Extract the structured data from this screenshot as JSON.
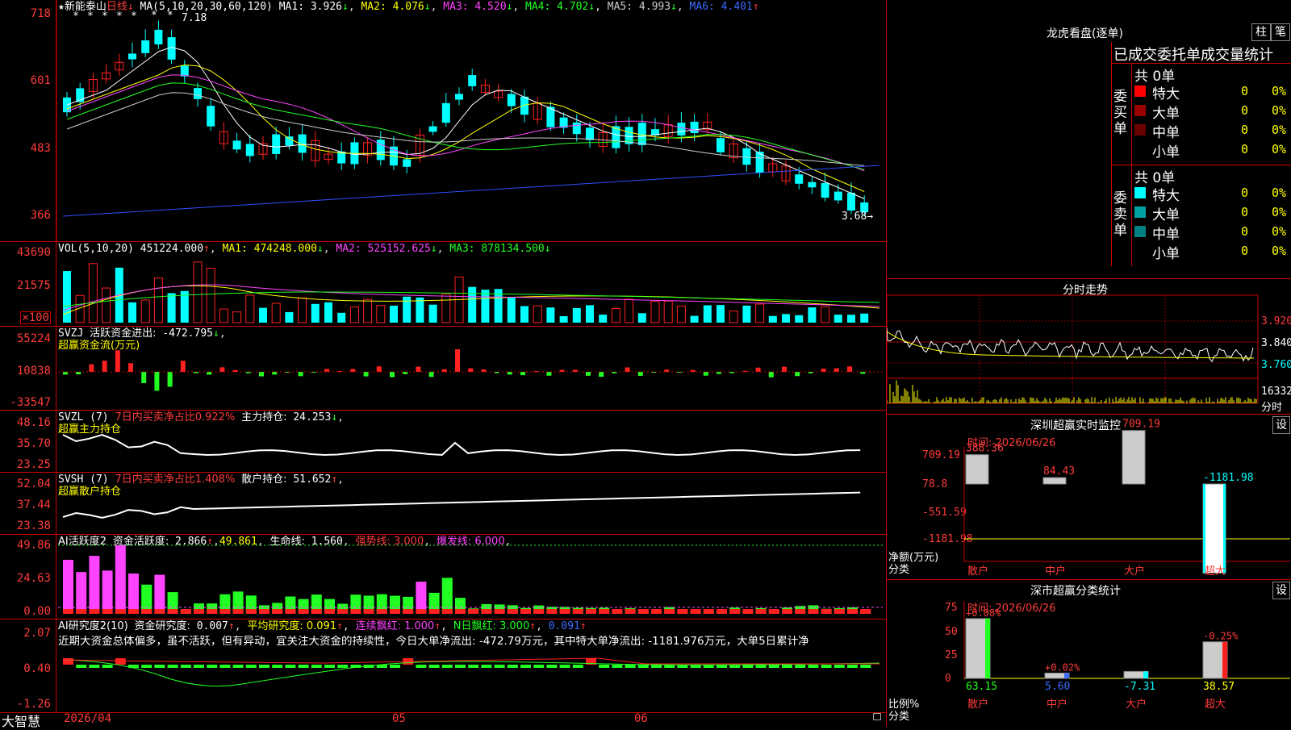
{
  "kline": {
    "name": "新能泰山",
    "period": "日线",
    "ma_label": "MA(5,10,20,30,60,120)",
    "ma": [
      {
        "label": "MA1:",
        "value": "3.926",
        "dir": "↓",
        "color": "#ffffff"
      },
      {
        "label": "MA2:",
        "value": "4.076",
        "dir": "↓",
        "color": "#ffff00"
      },
      {
        "label": "MA3:",
        "value": "4.520",
        "dir": "↓",
        "color": "#ff44ff"
      },
      {
        "label": "MA4:",
        "value": "4.702",
        "dir": "↓",
        "color": "#22ff22"
      },
      {
        "label": "MA5:",
        "value": "4.993",
        "dir": "↓",
        "color": "#cccccc"
      },
      {
        "label": "MA6:",
        "value": "4.401",
        "dir": "↑",
        "color": "#3b6bff"
      }
    ],
    "y_ticks": [
      "718",
      "601",
      "483",
      "366"
    ],
    "high_label": "7.18",
    "last_label": "3.68"
  },
  "vol": {
    "label": "VOL(5,10,20)",
    "value": "451224.000",
    "dir": "↑",
    "ma": [
      {
        "label": "MA1:",
        "value": "474248.000",
        "dir": "↓",
        "color": "#ffff00"
      },
      {
        "label": "MA2:",
        "value": "525152.625",
        "dir": "↓",
        "color": "#ff44ff"
      },
      {
        "label": "MA3:",
        "value": "878134.500",
        "dir": "↓",
        "color": "#22ff22"
      }
    ],
    "y_ticks": [
      "43690",
      "21575"
    ],
    "unit": "×100"
  },
  "svzj": {
    "label": "SVZJ",
    "item": "活跃资金进出:",
    "value": "-472.795",
    "dir": "↓",
    "sub": "超赢资金流(万元)",
    "y_ticks": [
      "55224",
      "10838",
      "-33547"
    ]
  },
  "svzl": {
    "label": "SVZL (7)",
    "item": "7日内买卖净占比0.922%",
    "item2": "主力持仓:",
    "value": "24.253",
    "dir": "↓",
    "sub": "超赢主力持仓",
    "y_ticks": [
      "48.16",
      "35.70",
      "23.25"
    ]
  },
  "svsh": {
    "label": "SVSH (7)",
    "item": "7日内买卖净占比1.408%",
    "item2": "散户持仓:",
    "value": "51.652",
    "dir": "↑",
    "sub": "超赢散户持仓",
    "y_ticks": [
      "52.04",
      "37.44",
      "23.38"
    ]
  },
  "ai_active": {
    "label": "AI活跃度2",
    "item": "资金活跃度:",
    "value": "2.866",
    "dir": "↑",
    "v2": "49.861",
    "life_label": "生命线:",
    "life": "1.560",
    "strong": "强势线: 3.000",
    "burst": "爆发线: 6.000",
    "y_ticks": [
      "49.86",
      "24.63",
      "0.00"
    ]
  },
  "ai_research": {
    "label": "AI研究度2(10)",
    "item": "资金研究度:",
    "value": "0.007",
    "dir": "↑",
    "avg": "平均研究度: 0.091",
    "cont": "连续飘红: 1.000",
    "n": "N日飘红: 3.000",
    "last": "0.091",
    "summary": "近期大资金总体偏多，虽不活跃，但有异动，宜关注大资金的持续性，今日大单净流出: -472.79万元，其中特大单净流出: -1181.976万元，大单5日累计净",
    "y_ticks": [
      "2.07",
      "0.40",
      "-1.26"
    ]
  },
  "x_axis": {
    "labels": [
      "2026/04",
      "05",
      "06"
    ],
    "brand": "大智慧"
  },
  "longhu": {
    "title": "龙虎看盘(逐单)",
    "btn1": "柱",
    "btn2": "笔",
    "tabs": [
      "已成交",
      "委托单",
      "成交量统计"
    ],
    "buy_side": "委买单",
    "sell_side": "委卖单",
    "buy_total": "共 0单",
    "sell_total": "共 0单",
    "buy_rows": [
      {
        "label": "特大",
        "count": "0",
        "pct": "0%",
        "color": "#ff0000"
      },
      {
        "label": "大单",
        "count": "0",
        "pct": "0%",
        "color": "#9b0000"
      },
      {
        "label": "中单",
        "count": "0",
        "pct": "0%",
        "color": "#6a0000"
      },
      {
        "label": "小单",
        "count": "0",
        "pct": "0%",
        "color": "#000000"
      }
    ],
    "sell_rows": [
      {
        "label": "特大",
        "count": "0",
        "pct": "0%",
        "color": "#00ffff"
      },
      {
        "label": "大单",
        "count": "0",
        "pct": "0%",
        "color": "#00a0a0"
      },
      {
        "label": "中单",
        "count": "0",
        "pct": "0%",
        "color": "#008080"
      },
      {
        "label": "小单",
        "count": "0",
        "pct": "0%",
        "color": "#000000"
      }
    ]
  },
  "intraday": {
    "title": "分时走势",
    "y_ticks": [
      "3.920",
      "3.840",
      "3.760",
      "16332"
    ],
    "label": "分时"
  },
  "sz_monitor": {
    "title": "深圳超赢实时监控",
    "btn": "设",
    "time": "时间: 2026/06/26",
    "y_ticks": [
      "709.19",
      "78.8",
      "-551.59",
      "-1181.98"
    ],
    "unit": "净额(万元)",
    "cat_label": "分类",
    "categories": [
      "散户",
      "中户",
      "大户",
      "超大"
    ],
    "values": [
      "388.36",
      "84.43",
      "709.19",
      "-1181.98"
    ]
  },
  "sz_class": {
    "title": "深市超赢分类统计",
    "btn": "设",
    "time": "时间: 2026/06/26",
    "y_ticks": [
      "75",
      "50",
      "25",
      "0"
    ],
    "unit": "比例%",
    "cat_label": "分类",
    "categories": [
      "散户",
      "中户",
      "大户",
      "超大"
    ],
    "top_labels": [
      "+0.08%",
      "+0.02%",
      "",
      "-0.25%"
    ],
    "values": [
      "63.15",
      "5.60",
      "-7.31",
      "38.57"
    ]
  }
}
